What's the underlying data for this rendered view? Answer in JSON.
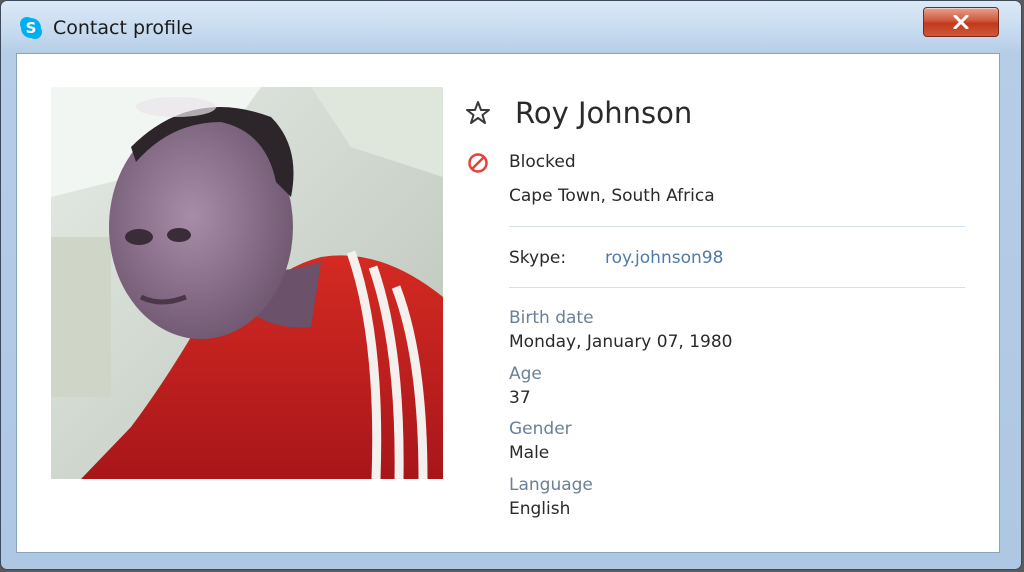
{
  "window": {
    "title": "Contact profile"
  },
  "contact": {
    "name": "Roy Johnson",
    "status": "Blocked",
    "location": "Cape Town, South Africa",
    "skype_label": "Skype:",
    "skype_id": "roy.johnson98"
  },
  "fields": [
    {
      "label": "Birth date",
      "value": "Monday, January 07, 1980"
    },
    {
      "label": "Age",
      "value": "37"
    },
    {
      "label": "Gender",
      "value": "Male"
    },
    {
      "label": "Language",
      "value": "English"
    }
  ],
  "icons": {
    "app": "skype-icon",
    "close": "close-icon",
    "favorite": "star-icon",
    "status": "blocked-icon"
  },
  "colors": {
    "skype_blue": "#00aff0",
    "blocked_red": "#e2423a",
    "link_blue": "#4f7aa7",
    "label_gray": "#6b7f96",
    "close_red": "#c2391d"
  }
}
